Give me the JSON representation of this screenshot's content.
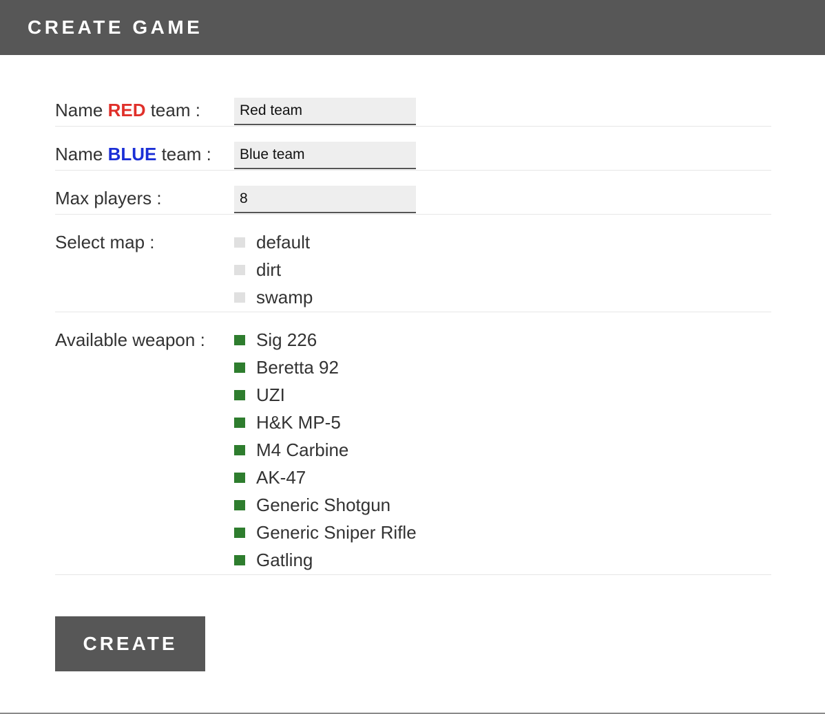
{
  "header": {
    "title": "CREATE GAME"
  },
  "red_team": {
    "label_prefix": "Name ",
    "label_color_word": "RED",
    "label_suffix": " team :",
    "value": "Red team",
    "accent_color": "#e0302a"
  },
  "blue_team": {
    "label_prefix": "Name ",
    "label_color_word": "BLUE",
    "label_suffix": " team :",
    "value": "Blue team",
    "accent_color": "#1b2fd6"
  },
  "max_players": {
    "label": "Max players :",
    "value": "8"
  },
  "maps": {
    "label": "Select map :",
    "options": [
      {
        "label": "default",
        "checked": false
      },
      {
        "label": "dirt",
        "checked": false
      },
      {
        "label": "swamp",
        "checked": false
      }
    ]
  },
  "weapons": {
    "label": "Available weapon :",
    "options": [
      {
        "label": "Sig 226",
        "checked": true
      },
      {
        "label": "Beretta 92",
        "checked": true
      },
      {
        "label": "UZI",
        "checked": true
      },
      {
        "label": "H&K MP-5",
        "checked": true
      },
      {
        "label": "M4 Carbine",
        "checked": true
      },
      {
        "label": "AK-47",
        "checked": true
      },
      {
        "label": "Generic Shotgun",
        "checked": true
      },
      {
        "label": "Generic Sniper Rifle",
        "checked": true
      },
      {
        "label": "Gatling",
        "checked": true
      }
    ],
    "checked_color": "#2e7d2e"
  },
  "actions": {
    "create_label": "CREATE"
  }
}
